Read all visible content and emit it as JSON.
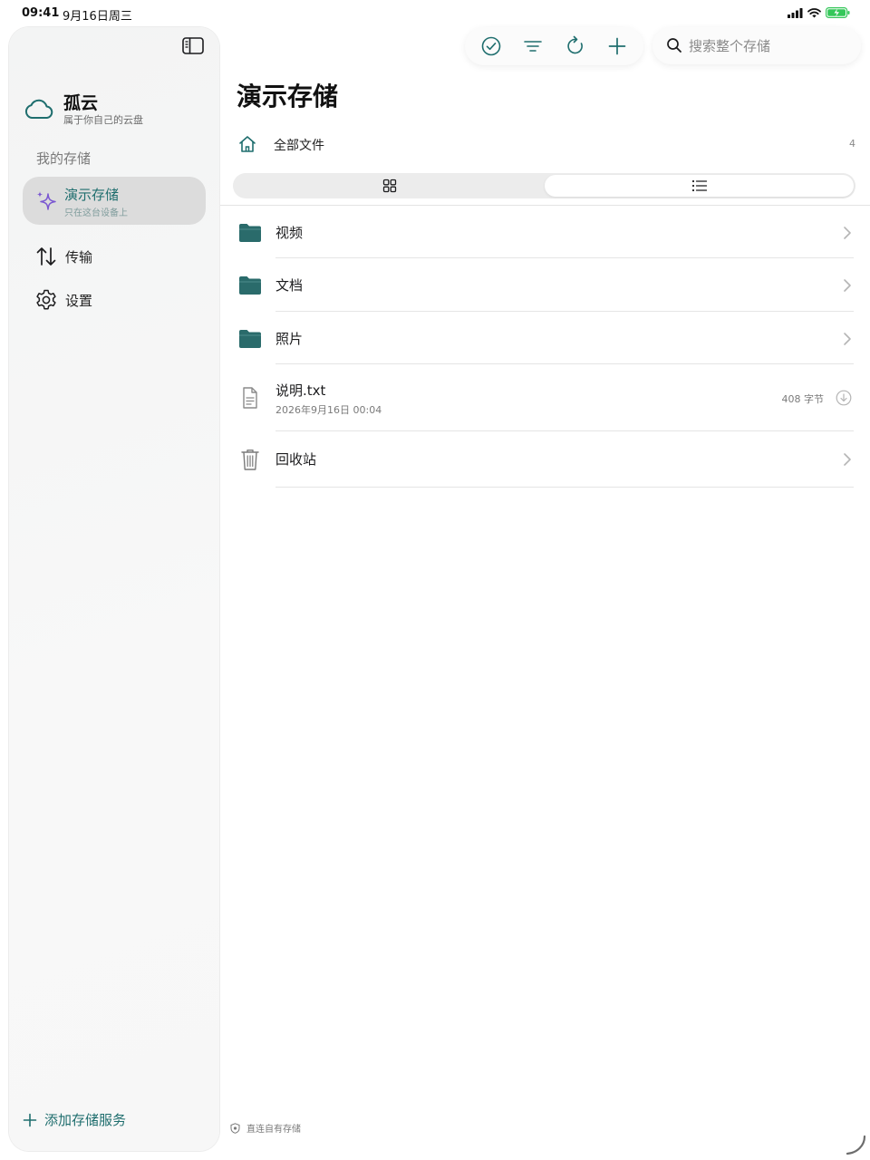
{
  "status_bar": {
    "time": "09:41",
    "date": "9月16日周三"
  },
  "sidebar": {
    "brand_name": "孤云",
    "brand_sub": "属于你自己的云盘",
    "section_label": "我的存储",
    "storage": {
      "name": "演示存储",
      "sub": "只在这台设备上"
    },
    "nav": [
      {
        "label": "传输",
        "icon": "arrows-up-down-icon"
      },
      {
        "label": "设置",
        "icon": "gear-icon"
      }
    ],
    "add_service_label": "添加存储服务"
  },
  "toolbar": {
    "buttons": [
      "select-check-icon",
      "filter-lines-icon",
      "refresh-icon",
      "plus-icon"
    ]
  },
  "search": {
    "placeholder": "搜索整个存储",
    "value": ""
  },
  "main": {
    "title": "演示存储",
    "breadcrumb_label": "全部文件",
    "item_count": "4",
    "view_mode": "list",
    "items": [
      {
        "name": "视频",
        "type": "folder"
      },
      {
        "name": "文档",
        "type": "folder"
      },
      {
        "name": "照片",
        "type": "folder"
      },
      {
        "name": "说明.txt",
        "type": "file",
        "date": "2026年9月16日 00:04",
        "size": "408 字节"
      },
      {
        "name": "回收站",
        "type": "trash"
      }
    ],
    "footer_note": "直连自有存储"
  },
  "colors": {
    "accent": "#1f6e6e",
    "folder": "#2a6b6b",
    "sparkle": "#7a57d1"
  }
}
